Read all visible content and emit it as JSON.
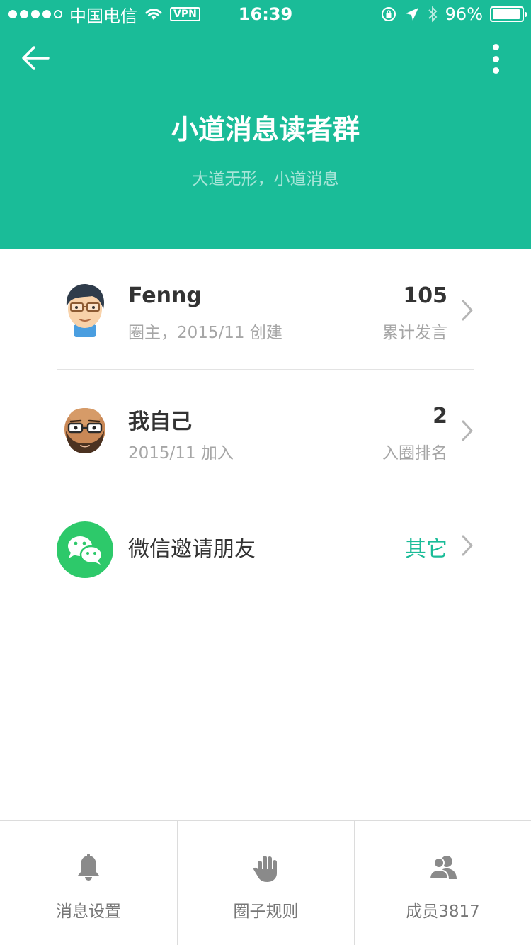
{
  "status_bar": {
    "carrier": "中国电信",
    "vpn": "VPN",
    "time": "16:39",
    "battery": "96%",
    "battery_level": 0.96
  },
  "header": {
    "title": "小道消息读者群",
    "subtitle": "大道无形，小道消息",
    "background_color": "#1abc98",
    "back_icon": "arrow-left-icon",
    "more_icon": "more-vertical-icon"
  },
  "members": [
    {
      "name": "Fenng",
      "meta": "圈主，2015/11 创建",
      "stat_value": "105",
      "stat_label": "累计发言",
      "avatar_icon": "avatar-glasses-icon"
    },
    {
      "name": "我自己",
      "meta": "2015/11 加入",
      "stat_value": "2",
      "stat_label": "入圈排名",
      "avatar_icon": "avatar-bald-beard-icon"
    }
  ],
  "invite": {
    "label": "微信邀请朋友",
    "other": "其它",
    "icon": "wechat-icon",
    "accent_color": "#1abc98"
  },
  "tabbar": [
    {
      "label": "消息设置",
      "icon": "bell-icon"
    },
    {
      "label": "圈子规则",
      "icon": "hand-icon"
    },
    {
      "label": "成员3817",
      "icon": "members-icon"
    }
  ]
}
